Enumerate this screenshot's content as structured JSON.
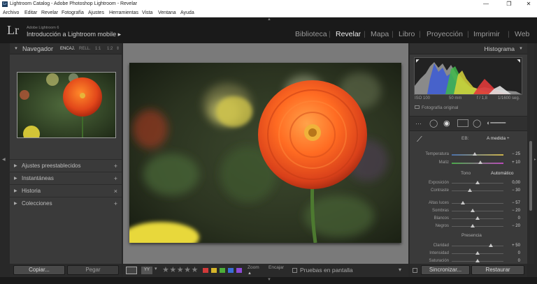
{
  "window": {
    "title": "Lightroom Catalog - Adobe Photoshop Lightroom - Revelar",
    "app_icon_text": "Lr",
    "minimize": "—",
    "maximize": "❐",
    "close": "✕"
  },
  "menu": [
    "Archivo",
    "Editar",
    "Revelar",
    "Fotografía",
    "Ajustes",
    "Herramientas",
    "Vista",
    "Ventana",
    "Ayuda"
  ],
  "identity": {
    "logo": "Lr",
    "subtitle": "Adobe Lightroom 6",
    "catalog": "Introducción a Lightroom mobile ▸"
  },
  "modules": [
    "Biblioteca",
    "Revelar",
    "Mapa",
    "Libro",
    "Proyección",
    "Imprimir",
    "Web"
  ],
  "active_module": "Revelar",
  "navigator": {
    "title": "Navegador",
    "zoom_options": [
      "ENCAJ.",
      "RELL.",
      "1:1",
      "1:2"
    ]
  },
  "left_sections": [
    {
      "label": "Ajustes preestablecidos",
      "action": "+"
    },
    {
      "label": "Instantáneas",
      "action": "+"
    },
    {
      "label": "Historia",
      "action": "×"
    },
    {
      "label": "Colecciones",
      "action": "+"
    }
  ],
  "left_buttons": {
    "copy": "Copiar...",
    "paste": "Pegar"
  },
  "toolbar": {
    "zoom_label": "Zoom",
    "fit_label": "Encajar",
    "proof_label": "Pruebas en pantalla",
    "stars": "★★★★★",
    "label_colors": [
      "#d23a3a",
      "#d6b52a",
      "#4cae3a",
      "#3a6ed6",
      "#8e4ad6"
    ]
  },
  "histogram": {
    "title": "Histograma",
    "iso": "ISO 100",
    "focal": "50 mm",
    "aperture": "f / 1,8",
    "shutter": "1/1600 seg.",
    "original": "Fotografía original"
  },
  "basic": {
    "wb_label": "EB:",
    "wb_value": "A medida ÷",
    "tone_label": "Tono",
    "tone_auto": "Automático",
    "presence_label": "Presencia",
    "sliders": [
      {
        "label": "Temperatura",
        "value": "− 25",
        "pos": 0.44,
        "group": "wb"
      },
      {
        "label": "Matiz",
        "value": "+ 10",
        "pos": 0.55,
        "group": "wb"
      },
      {
        "label": "Exposición",
        "value": "0,00",
        "pos": 0.5,
        "group": "tone"
      },
      {
        "label": "Contraste",
        "value": "− 30",
        "pos": 0.35,
        "group": "tone"
      },
      {
        "label": "Altas luces",
        "value": "− 57",
        "pos": 0.21,
        "group": "tone2"
      },
      {
        "label": "Sombras",
        "value": "− 20",
        "pos": 0.4,
        "group": "tone2"
      },
      {
        "label": "Blancos",
        "value": "0",
        "pos": 0.5,
        "group": "tone2"
      },
      {
        "label": "Negros",
        "value": "− 20",
        "pos": 0.4,
        "group": "tone2"
      },
      {
        "label": "Claridad",
        "value": "+ 50",
        "pos": 0.75,
        "group": "pres"
      },
      {
        "label": "Intensidad",
        "value": "0",
        "pos": 0.5,
        "group": "pres"
      },
      {
        "label": "Saturación",
        "value": "0",
        "pos": 0.5,
        "group": "pres"
      }
    ]
  },
  "right_buttons": {
    "sync": "Sincronizar...",
    "reset": "Restaurar"
  }
}
